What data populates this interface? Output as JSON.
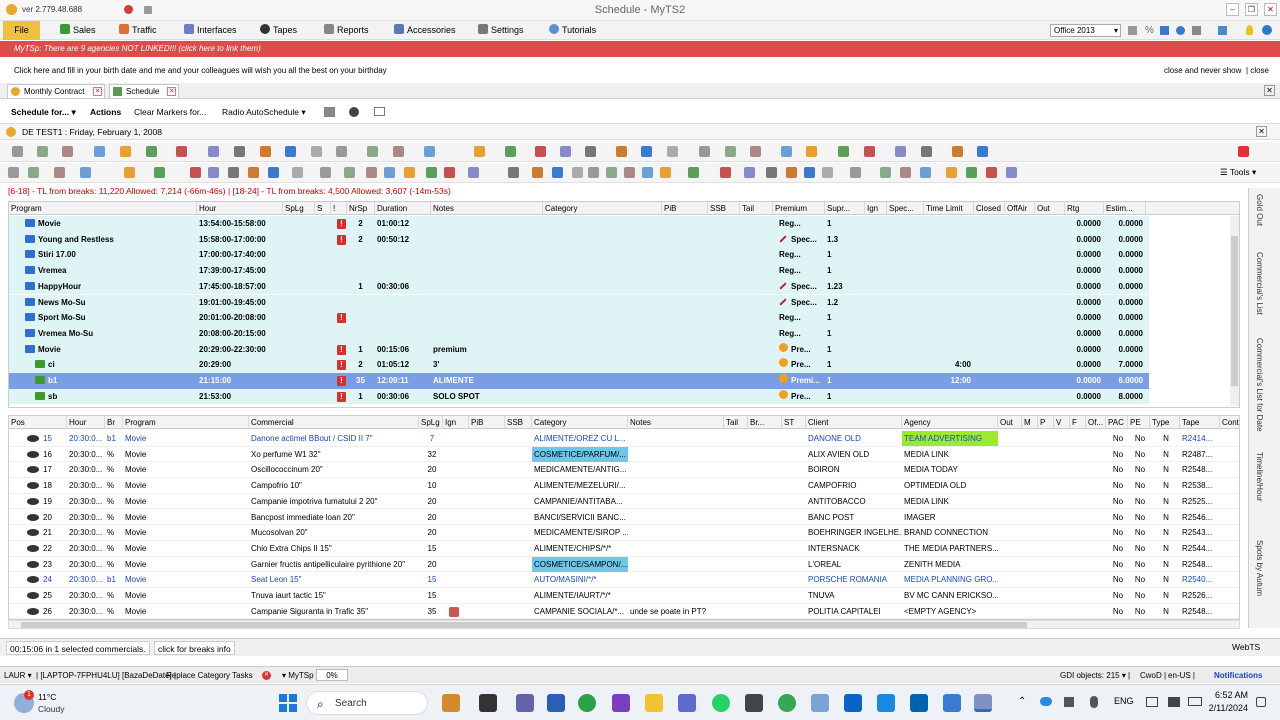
{
  "window": {
    "version": "ver 2.779.48.688",
    "title": "Schedule - MyTS2"
  },
  "menu": {
    "file": "File",
    "items": [
      "Sales",
      "Traffic",
      "Interfaces",
      "Tapes",
      "Reports",
      "Accessories",
      "Settings",
      "Tutorials"
    ],
    "theme": "Office 2013"
  },
  "banner": {
    "text": "MyTSp: There are 9 agencies NOT LINKED!!! (click here to link them)"
  },
  "birthday": {
    "text": "Click here and fill in your birth date and me and your colleagues will wish you all the best on your birthday",
    "close_never": "close and never show",
    "close": "close"
  },
  "doctabs": [
    "Monthly Contract",
    "Schedule"
  ],
  "schedule_toolbar": {
    "schedule_for": "Schedule for...",
    "actions": "Actions",
    "clear_markers": "Clear Markers for...",
    "radio_auto": "Radio AutoSchedule"
  },
  "subtab": {
    "label": "DE TEST1 : Friday, February 1, 2008"
  },
  "tools": "Tools",
  "tl_bar": "[6-18] - TL from breaks: 11,220 Allowed: 7,214 (-66m-46s) | [18-24] - TL from breaks: 4,500 Allowed: 3,607 (-14m-53s)",
  "upper": {
    "headers": [
      "Program",
      "Hour",
      "SpLg",
      "S",
      "!",
      "NrSp",
      "Duration",
      "Notes",
      "Category",
      "PiB",
      "SSB",
      "Tail",
      "Premium",
      "Supr...",
      "Ign",
      "Spec...",
      "Time Limit",
      "Closed",
      "OffAir",
      "Out",
      "Rtg",
      "Estim..."
    ],
    "rows": [
      {
        "program": "Movie",
        "hour": "13:54:00-15:58:00",
        "excl": "!",
        "nrsp": "2",
        "dur": "01:00:12",
        "notes": "",
        "prem": "Reg...",
        "supr": "1",
        "tl": "",
        "rtg": "0.0000",
        "est": "0.0000"
      },
      {
        "program": "Young and Restless",
        "hour": "15:58:00-17:00:00",
        "excl": "!",
        "nrsp": "2",
        "dur": "00:50:12",
        "notes": "",
        "prem": "Spec...",
        "supr": "1.3",
        "tl": "",
        "rtg": "0.0000",
        "est": "0.0000"
      },
      {
        "program": "Stiri 17.00",
        "hour": "17:00:00-17:40:00",
        "excl": "",
        "nrsp": "",
        "dur": "",
        "notes": "",
        "prem": "Reg...",
        "supr": "1",
        "tl": "",
        "rtg": "0.0000",
        "est": "0.0000"
      },
      {
        "program": "Vremea",
        "hour": "17:39:00-17:45:00",
        "excl": "",
        "nrsp": "",
        "dur": "",
        "notes": "",
        "prem": "Reg...",
        "supr": "1",
        "tl": "",
        "rtg": "0.0000",
        "est": "0.0000"
      },
      {
        "program": "HappyHour",
        "hour": "17:45:00-18:57:00",
        "excl": "",
        "nrsp": "1",
        "dur": "00:30:06",
        "notes": "",
        "prem": "Spec...",
        "supr": "1.23",
        "tl": "",
        "rtg": "0.0000",
        "est": "0.0000"
      },
      {
        "program": "News Mo-Su",
        "hour": "19:01:00-19:45:00",
        "excl": "",
        "nrsp": "",
        "dur": "",
        "notes": "",
        "prem": "Spec...",
        "supr": "1.2",
        "tl": "",
        "rtg": "0.0000",
        "est": "0.0000"
      },
      {
        "program": "Sport Mo-Su",
        "hour": "20:01:00-20:08:00",
        "excl": "!",
        "nrsp": "",
        "dur": "",
        "notes": "",
        "prem": "Reg...",
        "supr": "1",
        "tl": "",
        "rtg": "0.0000",
        "est": "0.0000"
      },
      {
        "program": "Vremea Mo-Su",
        "hour": "20:08:00-20:15:00",
        "excl": "",
        "nrsp": "",
        "dur": "",
        "notes": "",
        "prem": "Reg...",
        "supr": "1",
        "tl": "",
        "rtg": "0.0000",
        "est": "0.0000"
      },
      {
        "program": "Movie",
        "hour": "20:29:00-22:30:00",
        "excl": "!",
        "nrsp": "1",
        "dur": "00:15:06",
        "notes": "premium",
        "prem": "Pre...",
        "supr": "1",
        "tl": "",
        "rtg": "0.0000",
        "est": "0.0000"
      },
      {
        "program": "ci",
        "hour": "20:29:00",
        "excl": "!",
        "nrsp": "2",
        "dur": "01:05:12",
        "notes": "3'",
        "prem": "Pre...",
        "supr": "1",
        "tl": "4:00",
        "rtg": "0.0000",
        "est": "7.0000"
      },
      {
        "program": "b1",
        "hour": "21:15:00",
        "excl": "!",
        "nrsp": "35",
        "dur": "12:09:11",
        "notes": "ALIMENTE",
        "prem": "Premi...",
        "supr": "1",
        "tl": "12:00",
        "rtg": "0.0000",
        "est": "6.0000"
      },
      {
        "program": "sb",
        "hour": "21:53:00",
        "excl": "!",
        "nrsp": "1",
        "dur": "00:30:06",
        "notes": "SOLO SPOT",
        "prem": "Pre...",
        "supr": "1",
        "tl": "",
        "rtg": "0.0000",
        "est": "8.0000"
      }
    ]
  },
  "lower": {
    "headers": [
      "Pos",
      "Hour",
      "Br",
      "Program",
      "Commercial",
      "SpLg",
      "Ign",
      "PiB",
      "SSB",
      "Category",
      "Notes",
      "Tail",
      "Br...",
      "ST",
      "Client",
      "Agency",
      "Out",
      "M",
      "P",
      "V",
      "F",
      "Of...",
      "PAC",
      "PE",
      "Type",
      "Tape",
      "Cont"
    ],
    "rows": [
      {
        "pos": "15",
        "hour": "20:30:0...",
        "br": "b1",
        "prog": "Movie",
        "com": "Danone actimel BBout / CSID II 7\"",
        "splg": "7",
        "cat": "ALIMENTE/OREZ CU L...",
        "notes": "",
        "client": "DANONE OLD",
        "agency": "TEAM ADVERTISING",
        "pac": "No",
        "pe": "No",
        "type": "N",
        "tape": "R2414..."
      },
      {
        "pos": "16",
        "hour": "20:30:0...",
        "br": "%",
        "prog": "Movie",
        "com": "Xo perfume W1 32\"",
        "splg": "32",
        "cat": "COSMETICE/PARFUM/...",
        "notes": "",
        "client": "ALIX AVIEN OLD",
        "agency": "MEDIA LINK",
        "pac": "No",
        "pe": "No",
        "type": "N",
        "tape": "R2487..."
      },
      {
        "pos": "17",
        "hour": "20:30:0...",
        "br": "%",
        "prog": "Movie",
        "com": "Oscillococcinum 20\"",
        "splg": "20",
        "cat": "MEDICAMENTE/ANTIG...",
        "notes": "",
        "client": "BOIRON",
        "agency": "MEDIA TODAY",
        "pac": "No",
        "pe": "No",
        "type": "N",
        "tape": "R2548..."
      },
      {
        "pos": "18",
        "hour": "20:30:0...",
        "br": "%",
        "prog": "Movie",
        "com": "Campofrio 10\"",
        "splg": "10",
        "cat": "ALIMENTE/MEZELURI/...",
        "notes": "",
        "client": "CAMPOFRIO",
        "agency": "OPTIMEDIA OLD",
        "pac": "No",
        "pe": "No",
        "type": "N",
        "tape": "R2538..."
      },
      {
        "pos": "19",
        "hour": "20:30:0...",
        "br": "%",
        "prog": "Movie",
        "com": "Campanie impotriva fumatului 2 20\"",
        "splg": "20",
        "cat": "CAMPANIE/ANTITABA...",
        "notes": "",
        "client": "ANTITOBACCO",
        "agency": "MEDIA LINK",
        "pac": "No",
        "pe": "No",
        "type": "N",
        "tape": "R2525..."
      },
      {
        "pos": "20",
        "hour": "20:30:0...",
        "br": "%",
        "prog": "Movie",
        "com": "Bancpost immediate loan 20\"",
        "splg": "20",
        "cat": "BANCI/SERVICII BANC...",
        "notes": "",
        "client": "BANC POST",
        "agency": "IMAGER",
        "pac": "No",
        "pe": "No",
        "type": "N",
        "tape": "R2546..."
      },
      {
        "pos": "21",
        "hour": "20:30:0...",
        "br": "%",
        "prog": "Movie",
        "com": "Mucosolvan 20\"",
        "splg": "20",
        "cat": "MEDICAMENTE/SIROP ...",
        "notes": "",
        "client": "BOEHRINGER INGELHE...",
        "agency": "BRAND CONNECTION",
        "pac": "No",
        "pe": "No",
        "type": "N",
        "tape": "R2543..."
      },
      {
        "pos": "22",
        "hour": "20:30:0...",
        "br": "%",
        "prog": "Movie",
        "com": "Chio Extra Chips II 15\"",
        "splg": "15",
        "cat": "ALIMENTE/CHIPS/*/*",
        "notes": "",
        "client": "INTERSNACK",
        "agency": "THE MEDIA PARTNERS...",
        "pac": "No",
        "pe": "No",
        "type": "N",
        "tape": "R2544..."
      },
      {
        "pos": "23",
        "hour": "20:30:0...",
        "br": "%",
        "prog": "Movie",
        "com": "Garnier fructis antipelliculaire pyrithione 20\"",
        "splg": "20",
        "cat": "COSMETICE/SAMPON/...",
        "notes": "",
        "client": "L'OREAL",
        "agency": "ZENITH MEDIA",
        "pac": "No",
        "pe": "No",
        "type": "N",
        "tape": "R2548..."
      },
      {
        "pos": "24",
        "hour": "20:30:0...",
        "br": "b1",
        "prog": "Movie",
        "com": "Seat Leon 15\"",
        "splg": "15",
        "cat": "AUTO/MASINI/*/*",
        "notes": "",
        "client": "PORSCHE ROMANIA",
        "agency": "MEDIA PLANNING GRO...",
        "pac": "No",
        "pe": "No",
        "type": "N",
        "tape": "R2540..."
      },
      {
        "pos": "25",
        "hour": "20:30:0...",
        "br": "%",
        "prog": "Movie",
        "com": "Tnuva iaurt tactic 15\"",
        "splg": "15",
        "cat": "ALIMENTE/IAURT/*/*",
        "notes": "",
        "client": "TNUVA",
        "agency": "BV MC CANN ERICKSO...",
        "pac": "No",
        "pe": "No",
        "type": "N",
        "tape": "R2526..."
      },
      {
        "pos": "26",
        "hour": "20:30:0...",
        "br": "%",
        "prog": "Movie",
        "com": "Campanie Siguranta in Trafic 35\"",
        "splg": "35",
        "cat": "CAMPANIE SOCIALA/*...",
        "notes": "unde se poate in PT?",
        "client": "POLITIA CAPITALEI",
        "agency": "<EMPTY AGENCY>",
        "pac": "No",
        "pe": "No",
        "type": "N",
        "tape": "R2548..."
      }
    ]
  },
  "right_tabs": [
    "Gold Out",
    "Commercial's List",
    "Commercial's List for Date",
    "Timeline/Hour",
    "Spots by Autum"
  ],
  "status": {
    "selected": "00:15:06 in 1 selected commercials.",
    "breaks_info": "click for breaks info",
    "webts": "WebTS"
  },
  "bottom": {
    "laur": "LAUR",
    "laptop": "[LAPTOP-7FPHU4LU] [BazaDeDate]",
    "replace": "Replace Category Tasks",
    "mytsp": "MyTSp",
    "pct": "0%",
    "gdi": "GDI objects: 215",
    "cwod": "CwoD",
    "lang": "en-US",
    "notifications": "Notifications"
  },
  "taskbar": {
    "temp": "11°C",
    "weather": "Cloudy",
    "search": "Search",
    "lang": "ENG",
    "time": "6:52 AM",
    "date": "2/11/2024"
  }
}
